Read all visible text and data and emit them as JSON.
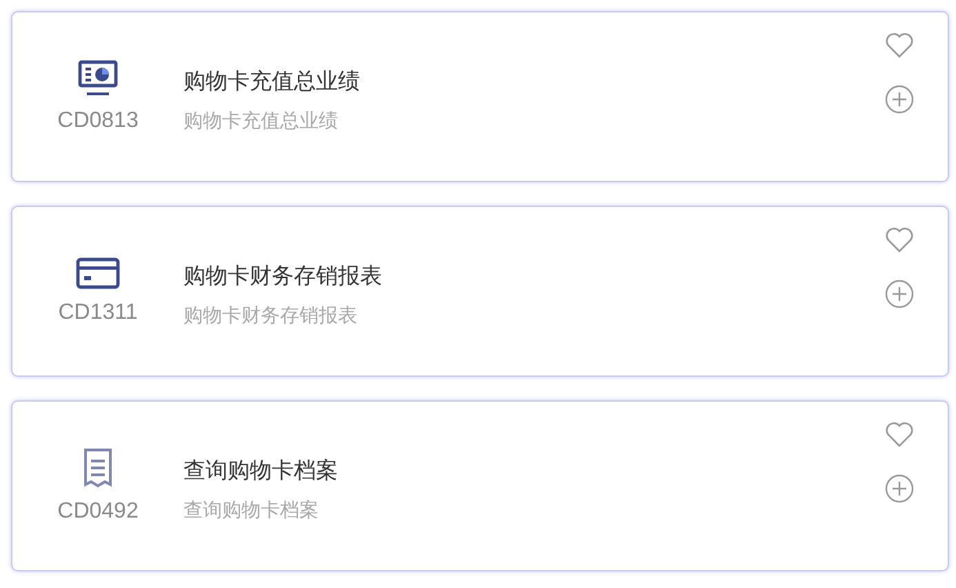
{
  "cards": [
    {
      "kind": "monitor",
      "code": "CD0813",
      "title": "购物卡充值总业绩",
      "subtitle": "购物卡充值总业绩",
      "favorite": false
    },
    {
      "kind": "card",
      "code": "CD1311",
      "title": "购物卡财务存销报表",
      "subtitle": "购物卡财务存销报表",
      "favorite": false
    },
    {
      "kind": "receipt",
      "code": "CD0492",
      "title": "查询购物卡档案",
      "subtitle": "查询购物卡档案",
      "favorite": false
    }
  ]
}
